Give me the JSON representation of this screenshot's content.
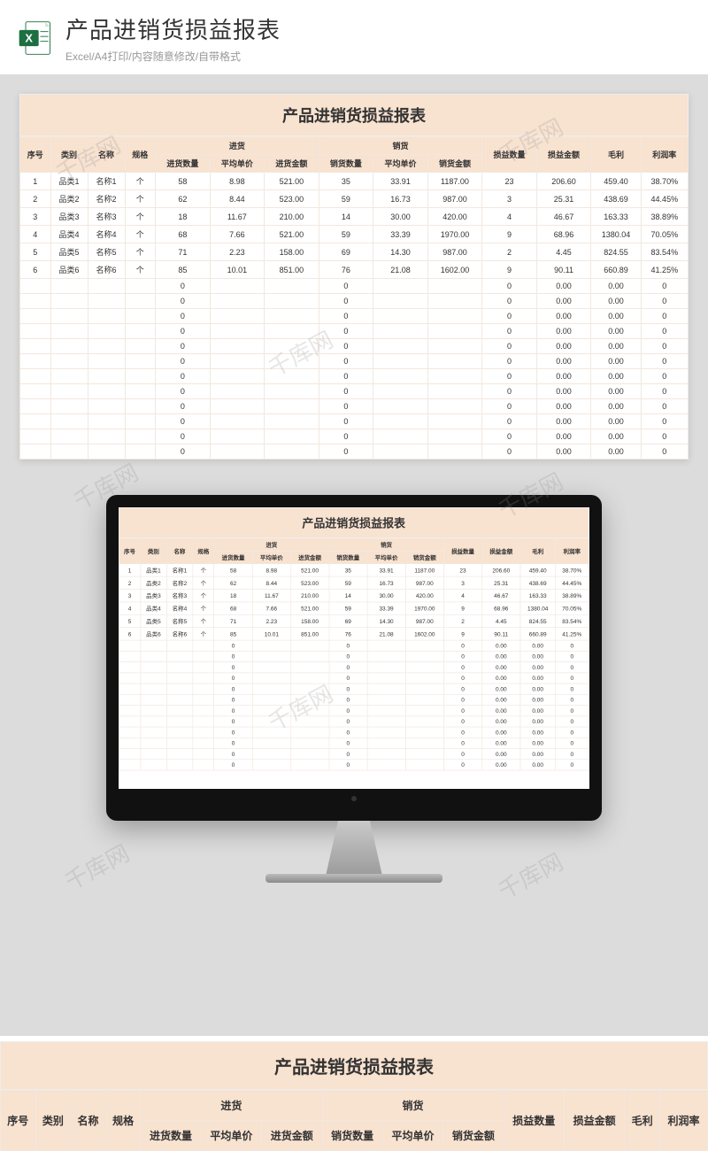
{
  "header": {
    "title": "产品进销货损益报表",
    "subtitle": "Excel/A4打印/内容随意修改/自带格式"
  },
  "watermark": "千库网",
  "report": {
    "title": "产品进销货损益报表",
    "group_purchase": "进货",
    "group_sales": "销货",
    "columns": {
      "seq": "序号",
      "category": "类别",
      "name": "名称",
      "spec": "规格",
      "purchase_qty": "进货数量",
      "purchase_price": "平均单价",
      "purchase_amount": "进货金额",
      "sales_qty": "销货数量",
      "sales_price": "平均单价",
      "sales_amount": "销货金额",
      "pl_qty": "损益数量",
      "pl_amount": "损益金额",
      "gross": "毛利",
      "margin": "利润率"
    },
    "rows": [
      {
        "seq": "1",
        "category": "品类1",
        "name": "名称1",
        "spec": "个",
        "pq": "58",
        "pp": "8.98",
        "pa": "521.00",
        "sq": "35",
        "sp": "33.91",
        "sa": "1187.00",
        "lq": "23",
        "la": "206.60",
        "g": "459.40",
        "m": "38.70%"
      },
      {
        "seq": "2",
        "category": "品类2",
        "name": "名称2",
        "spec": "个",
        "pq": "62",
        "pp": "8.44",
        "pa": "523.00",
        "sq": "59",
        "sp": "16.73",
        "sa": "987.00",
        "lq": "3",
        "la": "25.31",
        "g": "438.69",
        "m": "44.45%"
      },
      {
        "seq": "3",
        "category": "品类3",
        "name": "名称3",
        "spec": "个",
        "pq": "18",
        "pp": "11.67",
        "pa": "210.00",
        "sq": "14",
        "sp": "30.00",
        "sa": "420.00",
        "lq": "4",
        "la": "46.67",
        "g": "163.33",
        "m": "38.89%"
      },
      {
        "seq": "4",
        "category": "品类4",
        "name": "名称4",
        "spec": "个",
        "pq": "68",
        "pp": "7.66",
        "pa": "521.00",
        "sq": "59",
        "sp": "33.39",
        "sa": "1970.00",
        "lq": "9",
        "la": "68.96",
        "g": "1380.04",
        "m": "70.05%"
      },
      {
        "seq": "5",
        "category": "品类5",
        "name": "名称5",
        "spec": "个",
        "pq": "71",
        "pp": "2.23",
        "pa": "158.00",
        "sq": "69",
        "sp": "14.30",
        "sa": "987.00",
        "lq": "2",
        "la": "4.45",
        "g": "824.55",
        "m": "83.54%"
      },
      {
        "seq": "6",
        "category": "品类6",
        "name": "名称6",
        "spec": "个",
        "pq": "85",
        "pp": "10.01",
        "pa": "851.00",
        "sq": "76",
        "sp": "21.08",
        "sa": "1602.00",
        "lq": "9",
        "la": "90.11",
        "g": "660.89",
        "m": "41.25%"
      }
    ],
    "empty_row": {
      "pq": "0",
      "sq": "0",
      "lq": "0",
      "la": "0.00",
      "g": "0.00",
      "m": "0"
    },
    "empty_count": 12
  }
}
